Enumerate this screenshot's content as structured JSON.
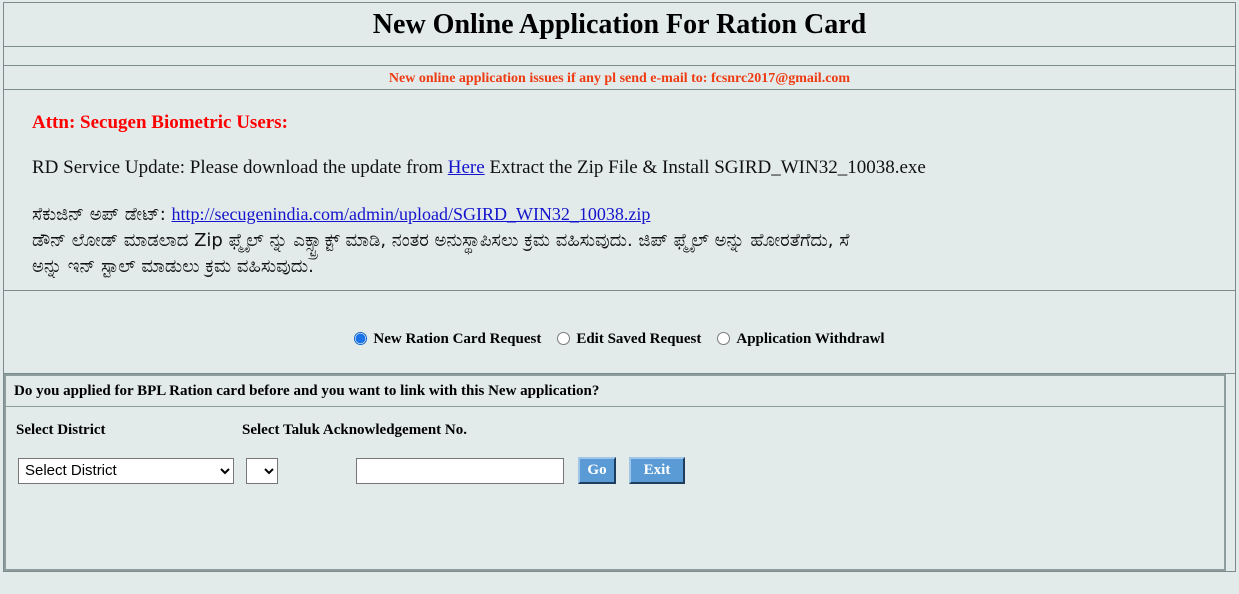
{
  "header": {
    "title": "New Online Application For Ration Card"
  },
  "notice": {
    "text": "New online application issues if any pl send e-mail to: fcsnrc2017@gmail.com",
    "color": "#ef3b12"
  },
  "secugen": {
    "attn_heading": "Attn: Secugen Biometric Users:",
    "rd_prefix": "RD Service Update: Please download the update from ",
    "rd_link_label": "Here",
    "rd_suffix": " Extract the Zip File & Install SGIRD_WIN32_10038.exe",
    "kannada_label": "ಸೆಕುಜಿನ್ ಅಪ್ ಡೇಟ್: ",
    "kannada_url": "http://secugenindia.com/admin/upload/SGIRD_WIN32_10038.zip",
    "kannada_line_2": "ಡೌನ್ ಲೋಡ್ ಮಾಡಲಾದ Zip ಫ್ಮೈಲ್ ನ್ನು ಎಕ್ಸ್ಟ್ರಾಕ್ಟ್ ಮಾಡಿ, ನಂತರ ಅನುಸ್ಥಾಪಿಸಲು ಕ್ರಮ ವಹಿಸುವುದು. ಜಿಪ್ ಫ್ಮೈಲ್ ಅನ್ನು ಹೋರತೆಗೆದು, ಸೆ",
    "kannada_line_3": "ಅನ್ನು ಇನ್ ಸ್ಟಾಲ್ ಮಾಡುಲು ಕ್ರಮ ವಹಿಸುವುದು."
  },
  "request_type": {
    "options": [
      {
        "label": "New Ration Card Request",
        "checked": true
      },
      {
        "label": "Edit Saved Request",
        "checked": false
      },
      {
        "label": "Application Withdrawl",
        "checked": false
      }
    ]
  },
  "bpl_panel": {
    "question": "Do you applied for BPL Ration card before and you want to link with this New application?",
    "label_district": "Select District",
    "label_taluk": "Select Taluk Acknowledgement No.",
    "district_selected": "Select District",
    "district_options": [
      "Select District"
    ],
    "taluk_selected": "",
    "taluk_options": [
      ""
    ],
    "ack_value": "",
    "ack_placeholder": "",
    "go_label": "Go",
    "exit_label": "Exit"
  },
  "theme": {
    "page_bg": "#e2eaea",
    "border": "#7b8a8a",
    "button_bg": "#5b9bd5",
    "link": "#1414cc",
    "attn_red": "#ff0000"
  }
}
